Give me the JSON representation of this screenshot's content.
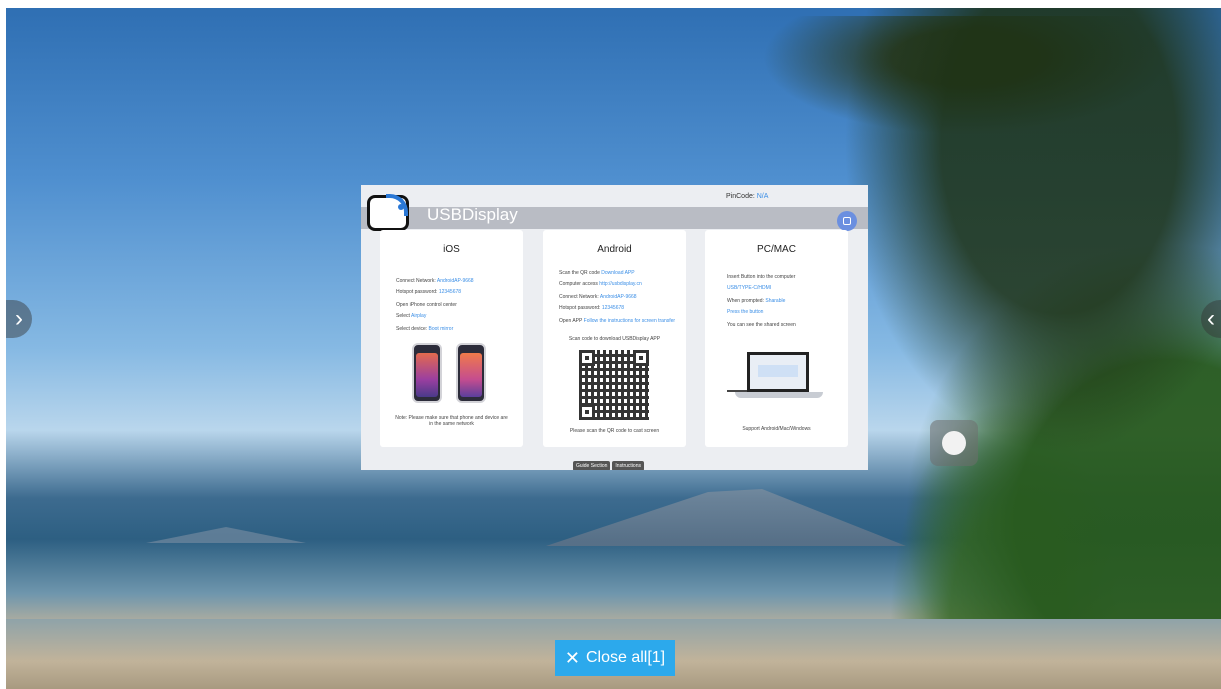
{
  "dialog": {
    "app_title": "USBDisplay",
    "pincode_label": "PinCode:",
    "pincode_value": "N/A",
    "cards": {
      "ios": {
        "title": "iOS",
        "network_label": "Connect Network:",
        "network_value": "AndroidAP-9668",
        "password_label": "Hotspot password:",
        "password_value": "12345678",
        "control_center": "Open iPhone control center",
        "select_label": "Select",
        "select_value": "Airplay",
        "device_label": "Select device:",
        "device_value": "Boot mirror",
        "note": "Note: Please make sure that phone and device are in the same network"
      },
      "android": {
        "title": "Android",
        "scan_label": "Scan the QR code",
        "scan_value": "Download APP",
        "access_label": "Computer access",
        "access_value": "http://usbdisplay.cn",
        "network_label": "Connect Network:",
        "network_value": "AndroidAP-9668",
        "password_label": "Hotspot password:",
        "password_value": "12345678",
        "open_label": "Open APP",
        "open_value": "Follow the instructions for screen transfer",
        "scan_download": "Scan code to download USBDisplay APP",
        "cast_note": "Please scan the QR code to cast screen"
      },
      "pc": {
        "title": "PC/MAC",
        "insert_label": "Insert Button into the computer",
        "insert_value": "USB/TYPE-C/HDMI",
        "prompted_label": "When prompted:",
        "prompted_value": "Sharable",
        "press": "Press the button",
        "shared": "You can see the shared screen",
        "support": "Support Android/Mac/Windows"
      }
    },
    "tabs": [
      "Guide Section",
      "Instructions"
    ]
  },
  "close_all": {
    "label": "Close all[1]"
  },
  "icons": {
    "left_arrow": "chevron-right-icon",
    "right_arrow": "chevron-left-icon",
    "close": "close-icon"
  }
}
